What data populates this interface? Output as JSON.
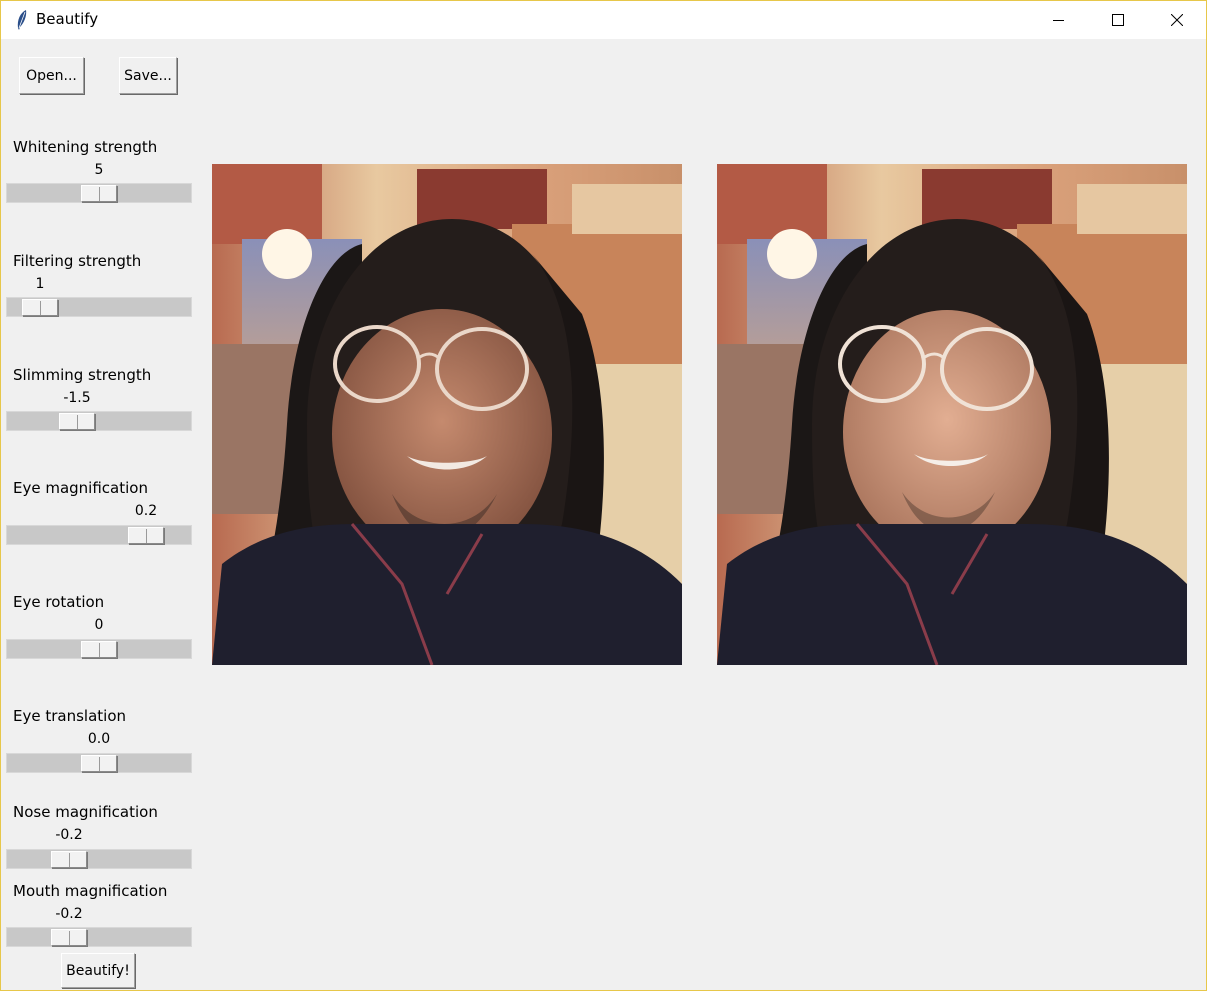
{
  "window": {
    "title": "Beautify",
    "controls": {
      "minimize_icon": "minimize-icon",
      "maximize_icon": "maximize-icon",
      "close_icon": "close-icon"
    }
  },
  "toolbar": {
    "open_label": "Open...",
    "save_label": "Save..."
  },
  "sliders": [
    {
      "label": "Whitening strength",
      "value": "5",
      "fraction": 0.5
    },
    {
      "label": "Filtering strength",
      "value": "1",
      "fraction": 0.1
    },
    {
      "label": "Slimming strength",
      "value": "-1.5",
      "fraction": 0.35
    },
    {
      "label": "Eye magnification",
      "value": "0.2",
      "fraction": 0.82
    },
    {
      "label": "Eye rotation",
      "value": "0",
      "fraction": 0.5
    },
    {
      "label": "Eye translation",
      "value": "0.0",
      "fraction": 0.5
    },
    {
      "label": "Nose magnification",
      "value": "-0.2",
      "fraction": 0.3
    },
    {
      "label": "Mouth magnification",
      "value": "-0.2",
      "fraction": 0.3
    }
  ],
  "actions": {
    "beautify_label": "Beautify!"
  },
  "images": {
    "original": "original-photo",
    "result": "beautified-photo"
  },
  "colors": {
    "title_border": "#e7c74a",
    "background": "#f0f0f0",
    "trough": "#c8c8c8"
  }
}
